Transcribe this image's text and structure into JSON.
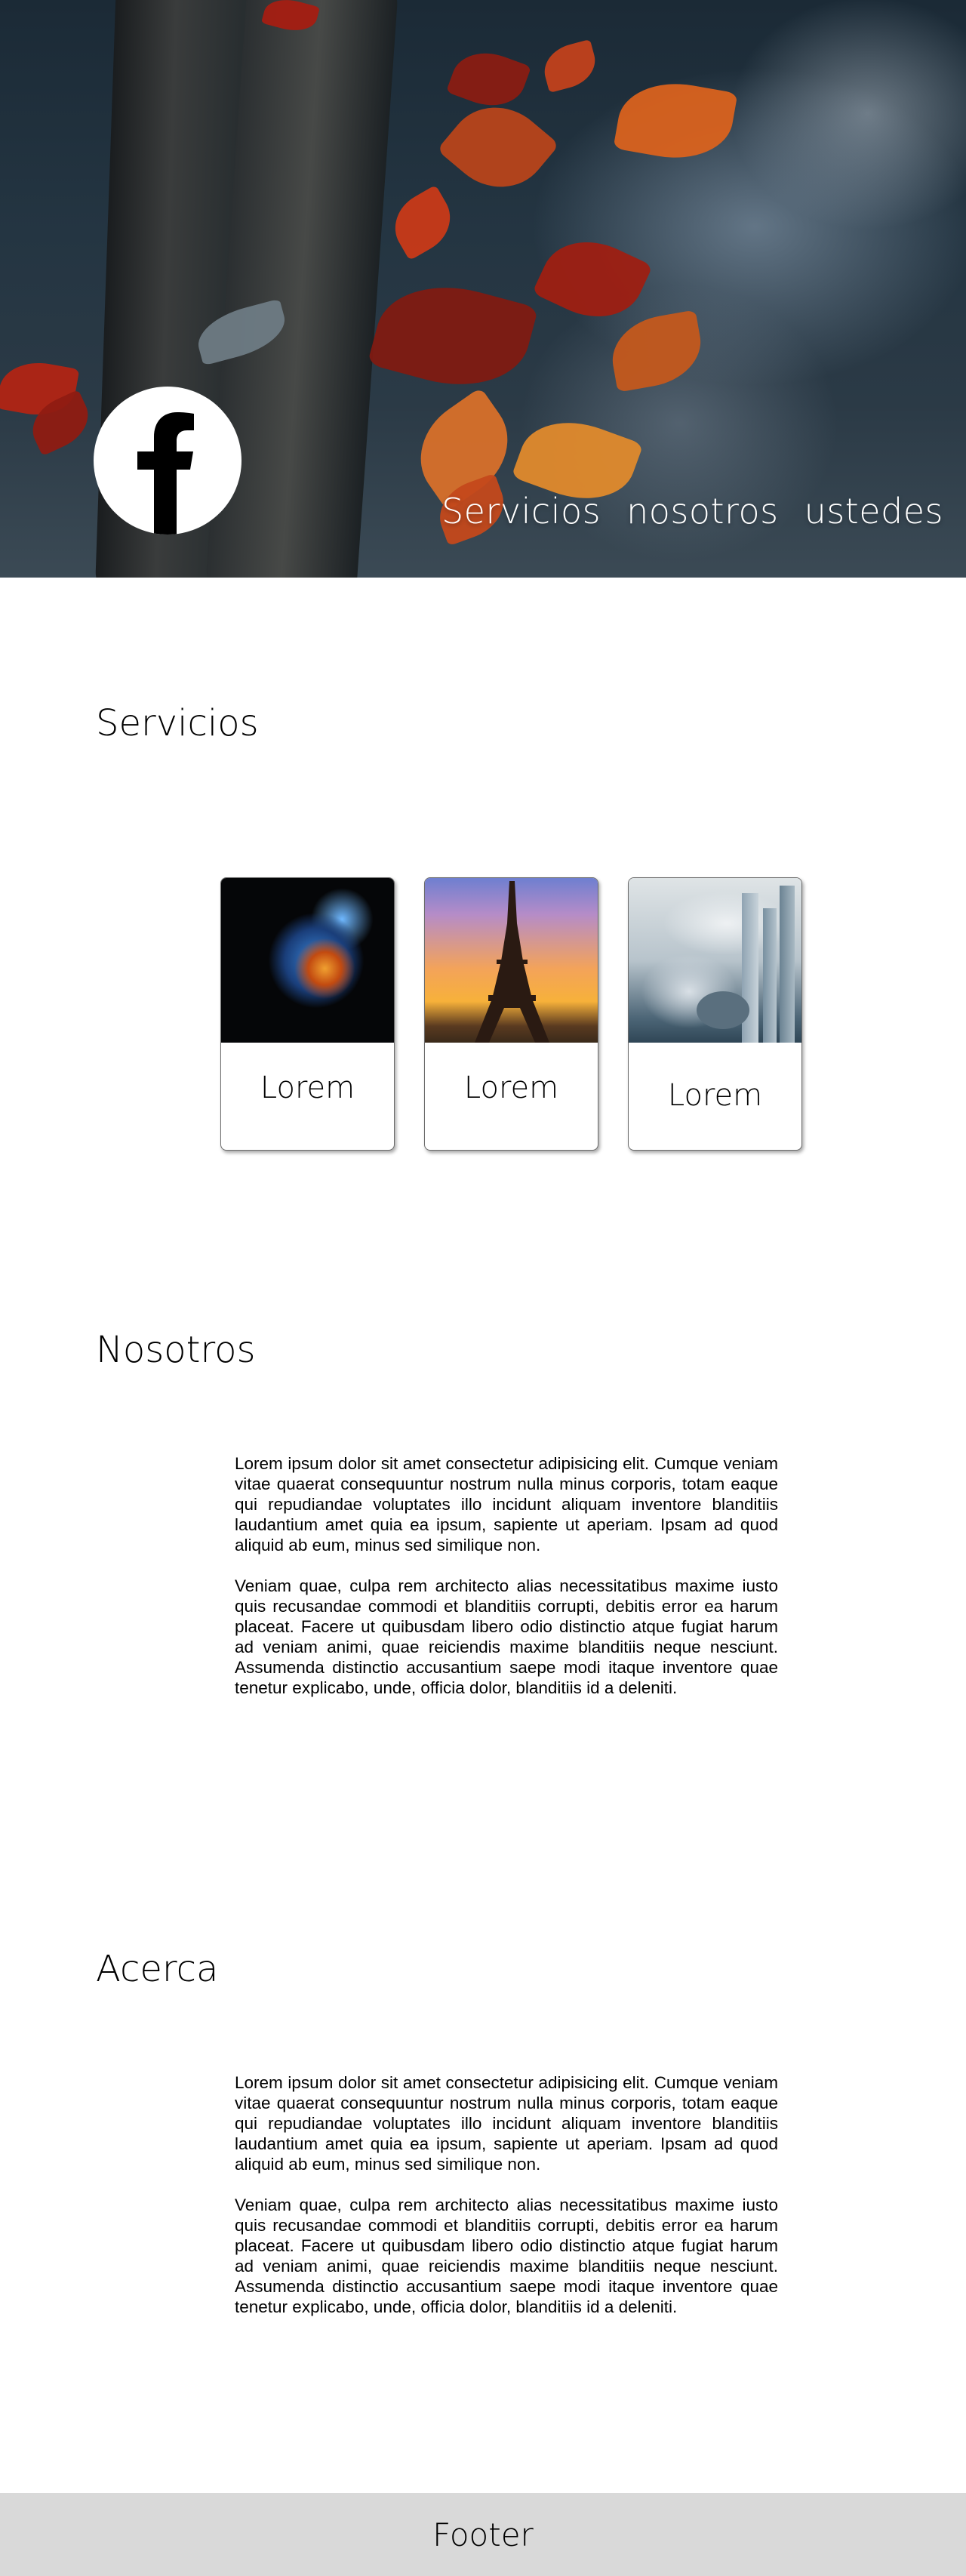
{
  "header": {
    "logo_icon": "facebook-icon",
    "nav": [
      {
        "label": "Servicios"
      },
      {
        "label": "nosotros"
      },
      {
        "label": "ustedes"
      }
    ]
  },
  "servicios": {
    "title": "Servicios",
    "cards": [
      {
        "image": "burning-planet-image",
        "caption": "Lorem"
      },
      {
        "image": "eiffel-tower-sunset-image",
        "caption": "Lorem"
      },
      {
        "image": "city-skyline-clouds-image",
        "caption": "Lorem"
      }
    ]
  },
  "nosotros": {
    "title": "Nosotros",
    "paragraphs": [
      "Lorem ipsum dolor sit amet consectetur adipisicing elit. Cumque veniam vitae quaerat consequuntur nostrum nulla minus corporis, totam eaque qui repudiandae voluptates illo incidunt aliquam inventore blanditiis laudantium amet quia ea ipsum, sapiente ut aperiam. Ipsam ad quod aliquid ab eum, minus sed similique non.",
      "Veniam quae, culpa rem architecto alias necessitatibus maxime iusto quis recusandae commodi et blanditiis corrupti, debitis error ea harum placeat. Facere ut quibusdam libero odio distinctio atque fugiat harum ad veniam animi, quae reiciendis maxime blanditiis neque nesciunt. Assumenda distinctio accusantium saepe modi itaque inventore quae tenetur explicabo, unde, officia dolor, blanditiis id a deleniti."
    ]
  },
  "acerca": {
    "title": "Acerca",
    "paragraphs": [
      "Lorem ipsum dolor sit amet consectetur adipisicing elit. Cumque veniam vitae quaerat consequuntur nostrum nulla minus corporis, totam eaque qui repudiandae voluptates illo incidunt aliquam inventore blanditiis laudantium amet quia ea ipsum, sapiente ut aperiam. Ipsam ad quod aliquid ab eum, minus sed similique non.",
      "Veniam quae, culpa rem architecto alias necessitatibus maxime iusto quis recusandae commodi et blanditiis corrupti, debitis error ea harum placeat. Facere ut quibusdam libero odio distinctio atque fugiat harum ad veniam animi, quae reiciendis maxime blanditiis neque nesciunt. Assumenda distinctio accusantium saepe modi itaque inventore quae tenetur explicabo, unde, officia dolor, blanditiis id a deleniti."
    ]
  },
  "footer": {
    "label": "Footer"
  },
  "colors": {
    "footer_bg": "#d9d9d9",
    "text": "#000000",
    "nav_text": "#ffffff"
  }
}
